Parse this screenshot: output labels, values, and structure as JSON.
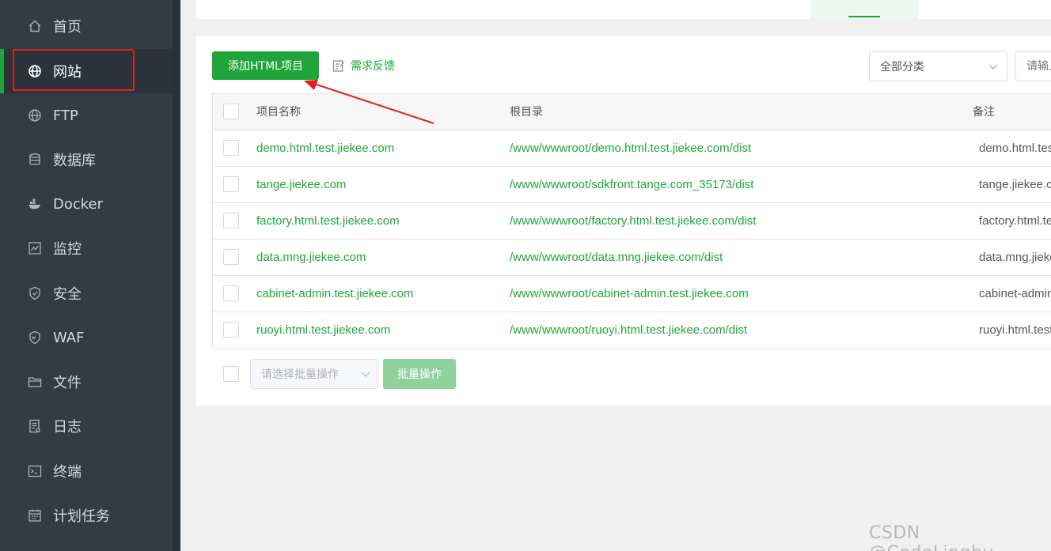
{
  "sidebar": {
    "items": [
      {
        "label": "首页",
        "icon": "home-icon"
      },
      {
        "label": "网站",
        "icon": "globe-icon",
        "active": true
      },
      {
        "label": "FTP",
        "icon": "ftp-globe-icon"
      },
      {
        "label": "数据库",
        "icon": "database-icon"
      },
      {
        "label": "Docker",
        "icon": "docker-icon"
      },
      {
        "label": "监控",
        "icon": "monitor-icon"
      },
      {
        "label": "安全",
        "icon": "shield-icon"
      },
      {
        "label": "WAF",
        "icon": "waf-shield-icon"
      },
      {
        "label": "文件",
        "icon": "folder-icon"
      },
      {
        "label": "日志",
        "icon": "log-icon"
      },
      {
        "label": "终端",
        "icon": "terminal-icon"
      },
      {
        "label": "计划任务",
        "icon": "calendar-icon"
      }
    ]
  },
  "toolbar": {
    "add_label": "添加HTML项目",
    "feedback_label": "需求反馈",
    "category_value": "全部分类",
    "search_placeholder": "请输入"
  },
  "table": {
    "headers": {
      "name": "项目名称",
      "root": "根目录",
      "note": "备注"
    },
    "rows": [
      {
        "name": "demo.html.test.jiekee.com",
        "root": "/www/wwwroot/demo.html.test.jiekee.com/dist",
        "note": "demo.html.test.jiekee.com"
      },
      {
        "name": "tange.jiekee.com",
        "root": "/www/wwwroot/sdkfront.tange.com_35173/dist",
        "note": "tange.jiekee.com"
      },
      {
        "name": "factory.html.test.jiekee.com",
        "root": "/www/wwwroot/factory.html.test.jiekee.com/dist",
        "note": "factory.html.test.jiekee.com"
      },
      {
        "name": "data.mng.jiekee.com",
        "root": "/www/wwwroot/data.mng.jiekee.com/dist",
        "note": "data.mng.jiekee.com"
      },
      {
        "name": "cabinet-admin.test.jiekee.com",
        "root": "/www/wwwroot/cabinet-admin.test.jiekee.com",
        "note": "cabinet-admin.test.jiekee.com"
      },
      {
        "name": "ruoyi.html.test.jiekee.com",
        "root": "/www/wwwroot/ruoyi.html.test.jiekee.com/dist",
        "note": "ruoyi.html.test.jiekee.com"
      }
    ]
  },
  "batch": {
    "select_placeholder": "请选择批量操作",
    "button_label": "批量操作"
  },
  "watermark": "CSDN @CodeLinghu",
  "colors": {
    "sidebar_bg": "#333b44",
    "accent": "#20a53a",
    "annotation_red": "#e02020"
  }
}
